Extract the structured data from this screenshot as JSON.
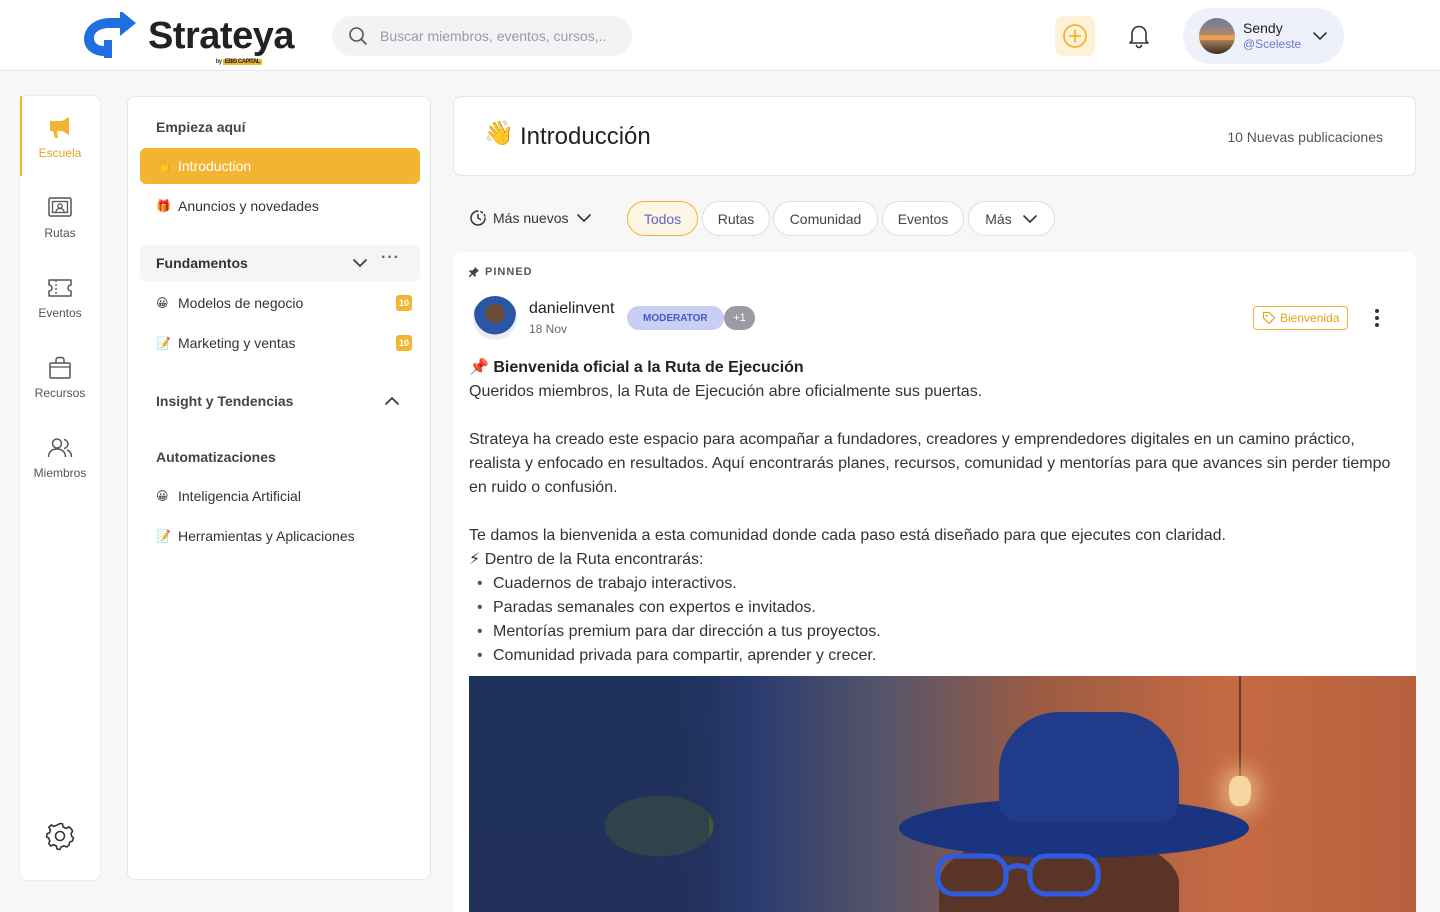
{
  "brand": {
    "name": "Strateya",
    "sub_prefix": "by",
    "sub_company": "EBIS CAPITAL"
  },
  "search": {
    "placeholder": "Buscar miembros, eventos, cursos,.."
  },
  "user": {
    "name": "Sendy",
    "handle": "@Sceleste"
  },
  "nav": [
    {
      "label": "Escuela",
      "icon": "megaphone-icon",
      "active": true
    },
    {
      "label": "Rutas",
      "icon": "presentation-icon"
    },
    {
      "label": "Eventos",
      "icon": "ticket-icon"
    },
    {
      "label": "Recursos",
      "icon": "shopping-bag-icon"
    },
    {
      "label": "Miembros",
      "icon": "users-icon"
    }
  ],
  "course": {
    "start_title": "Empieza  aquí",
    "start_items": [
      {
        "emoji": "👋",
        "label": "Introduction",
        "active": true
      },
      {
        "emoji": "🎁",
        "label": "Anuncios y novedades"
      }
    ],
    "group_fundamentos": {
      "label": "Fundamentos",
      "items": [
        {
          "emoji": "😀",
          "label": "Modelos de negocio",
          "badge": "10"
        },
        {
          "emoji": "📝",
          "label": "Marketing y ventas",
          "badge": "10"
        }
      ]
    },
    "insight_title": "Insight y Tendencias",
    "auto_title": "Automatizaciones",
    "auto_items": [
      {
        "emoji": "😀",
        "label": "Inteligencia Artificial"
      },
      {
        "emoji": "📝",
        "label": "Herramientas y Aplicaciones"
      }
    ]
  },
  "main": {
    "title_emoji": "👋",
    "title": "Introducción",
    "new_posts": "10 Nuevas publicaciones",
    "sort_label": "Más nuevos",
    "filters": [
      "Todos",
      "Rutas",
      "Comunidad",
      "Eventos",
      "Más"
    ]
  },
  "post": {
    "pinned_label": "PINNED",
    "author": "danielinvent",
    "date": "18 Nov",
    "role_badge": "MODERATOR",
    "extra_badge": "+1",
    "tag": "Bienvenida",
    "title_emoji": "📌",
    "title": "Bienvenida oficial a la Ruta de Ejecución",
    "intro": "Queridos miembros, la Ruta de Ejecución abre oficialmente sus puertas.",
    "paragraph": "Strateya ha creado este espacio para acompañar a fundadores, creadores y emprendedores digitales en un camino práctico, realista y enfocado en resultados. Aquí encontrarás planes, recursos, comunidad y mentorías para que avances sin perder tiempo en ruido o confusión.",
    "welcome": "Te damos la bienvenida a esta comunidad donde cada paso está diseñado para que ejecutes con claridad.",
    "list_emoji": "⚡",
    "list_intro": "Dentro de la Ruta encontrarás:",
    "bullets": [
      "Cuadernos de trabajo interactivos.",
      "Paradas semanales con expertos e invitados.",
      "Mentorías premium para dar dirección a tus proyectos.",
      "Comunidad privada para compartir, aprender y crecer."
    ]
  },
  "colors": {
    "accent": "#f2b532",
    "moderator_bg": "#c9cff4",
    "moderator_text": "#4a57c2"
  }
}
